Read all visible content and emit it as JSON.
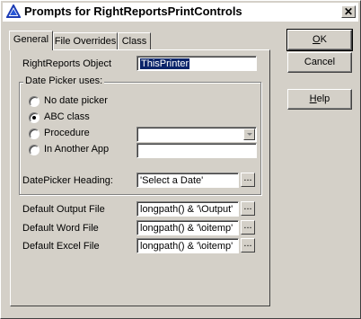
{
  "window": {
    "title": "Prompts for RightReportsPrintControls",
    "close_glyph": "✕"
  },
  "tabs": [
    {
      "label": "General"
    },
    {
      "label": "File Overrides"
    },
    {
      "label": "Class"
    }
  ],
  "form": {
    "object_label": "RightReports Object",
    "object_value": "ThisPrinter",
    "group_title": "Date Picker uses:",
    "radios": [
      {
        "label": "No date picker",
        "selected": false
      },
      {
        "label": "ABC class",
        "selected": true
      },
      {
        "label": "Procedure",
        "selected": false
      },
      {
        "label": "In Another App",
        "selected": false
      }
    ],
    "procedure_value": "",
    "another_app_value": "",
    "heading_label": "DatePicker Heading:",
    "heading_value": "'Select a Date'",
    "output_label": "Default Output File",
    "output_value": "longpath() & '\\Output'",
    "word_label": "Default Word File",
    "word_value": "longpath() & '\\oitemp'",
    "excel_label": "Default Excel File",
    "excel_value": "longpath() & '\\oitemp'",
    "ellipsis": "..."
  },
  "buttons": {
    "ok_first": "O",
    "ok_rest": "K",
    "cancel": "Cancel",
    "help_first": "H",
    "help_rest": "elp"
  }
}
